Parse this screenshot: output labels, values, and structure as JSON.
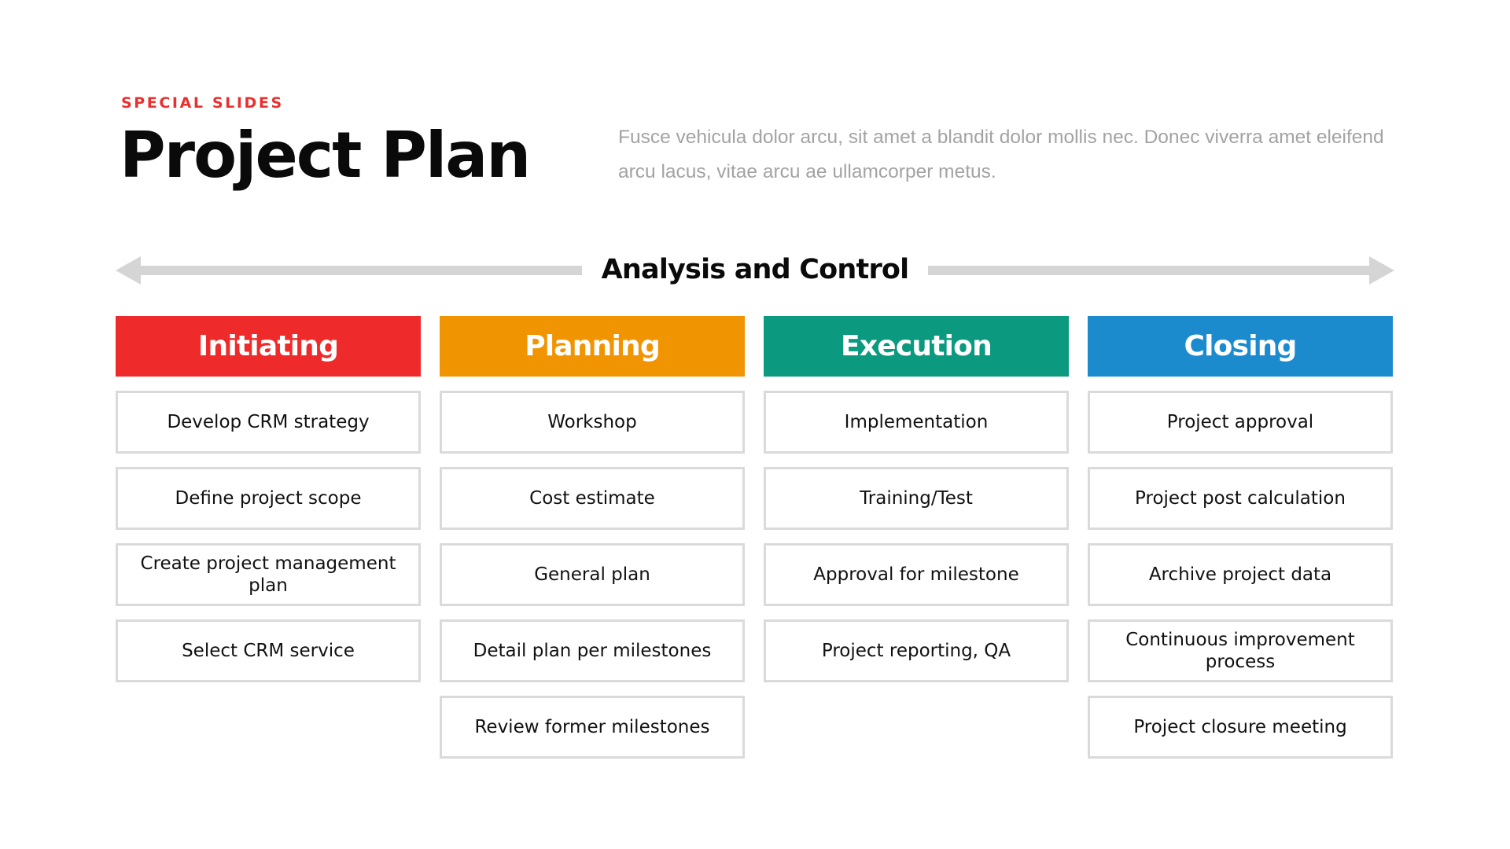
{
  "header": {
    "eyebrow": "SPECIAL SLIDES",
    "title": "Project Plan",
    "description": "Fusce vehicula dolor arcu, sit amet a blandit dolor mollis nec. Donec viverra amet eleifend arcu lacus, vitae arcu ae ullamcorper metus."
  },
  "timeline": {
    "label": "Analysis and Control",
    "left_icon": "arrow-left-icon",
    "right_icon": "arrow-right-icon",
    "arrow_color": "#d6d5d6"
  },
  "colors": {
    "eyebrow": "#e8302f",
    "description": "#a3a3a3",
    "box_border": "#dadada"
  },
  "phases": [
    {
      "label": "Initiating",
      "color": "#ee2a2a",
      "tasks": [
        "Develop CRM strategy",
        "Define project scope",
        "Create project management plan",
        "Select CRM service"
      ]
    },
    {
      "label": "Planning",
      "color": "#f19402",
      "tasks": [
        "Workshop",
        "Cost estimate",
        "General plan",
        "Detail plan per milestones",
        "Review former milestones"
      ]
    },
    {
      "label": "Execution",
      "color": "#0b9980",
      "tasks": [
        "Implementation",
        "Training/Test",
        "Approval for milestone",
        "Project reporting, QA"
      ]
    },
    {
      "label": "Closing",
      "color": "#1b8bce",
      "tasks": [
        "Project approval",
        "Project post calculation",
        "Archive project data",
        "Continuous improvement process",
        "Project closure meeting"
      ]
    }
  ]
}
